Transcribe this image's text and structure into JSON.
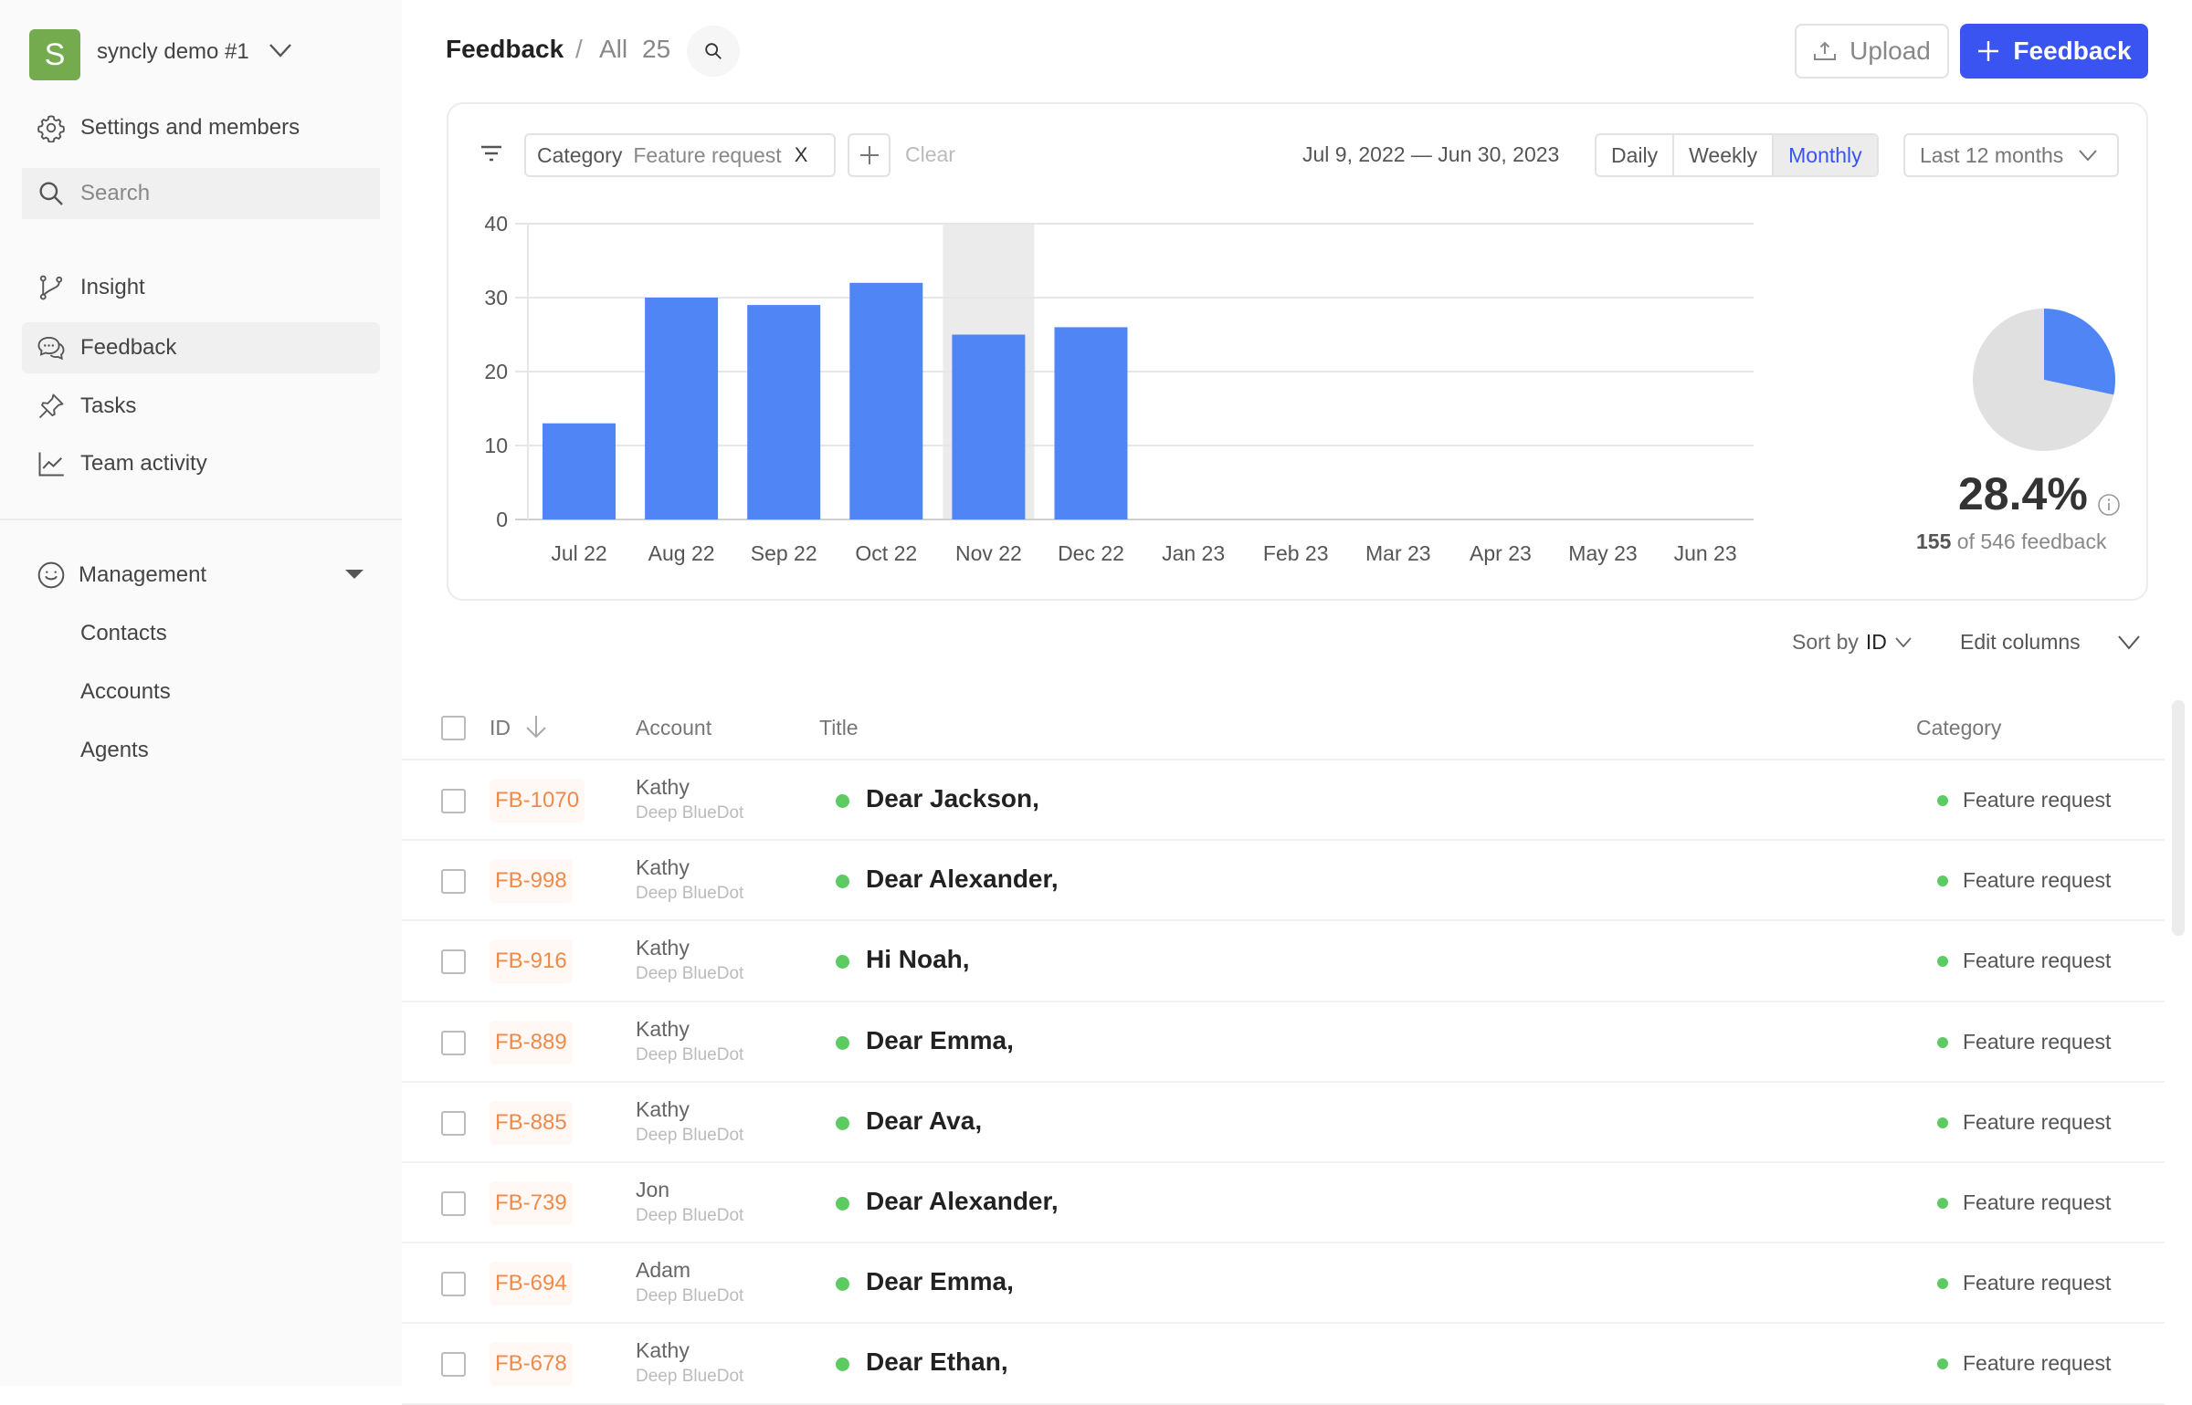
{
  "sidebar": {
    "workspace": {
      "initial": "S",
      "name": "syncly demo #1"
    },
    "settings_label": "Settings and members",
    "search_placeholder": "Search",
    "nav": [
      {
        "label": "Insight",
        "icon": "branch-icon"
      },
      {
        "label": "Feedback",
        "icon": "chat-bubbles-icon",
        "active": true
      },
      {
        "label": "Tasks",
        "icon": "pin-icon"
      },
      {
        "label": "Team activity",
        "icon": "line-chart-icon"
      }
    ],
    "management": {
      "label": "Management",
      "items": [
        "Contacts",
        "Accounts",
        "Agents"
      ]
    }
  },
  "header": {
    "title": "Feedback",
    "separator": "/",
    "view": "All",
    "count": "25",
    "upload_label": "Upload",
    "new_feedback_label": "Feedback"
  },
  "filters": {
    "chip_key": "Category",
    "chip_value": "Feature request",
    "chip_remove": "X",
    "clear_label": "Clear",
    "date_range": "Jul 9, 2022 — Jun 30, 2023",
    "granularity": [
      "Daily",
      "Weekly",
      "Monthly"
    ],
    "granularity_selected": "Monthly",
    "period": "Last 12 months"
  },
  "colors": {
    "accent": "#3a54f1",
    "bar": "#5085f5",
    "pie_rest": "#e0e0e0",
    "status_green": "#5ecb62",
    "id_orange": "#ef8a4a"
  },
  "chart_data": [
    {
      "type": "bar",
      "title": "",
      "xlabel": "",
      "ylabel": "",
      "categories": [
        "Jul 22",
        "Aug 22",
        "Sep 22",
        "Oct 22",
        "Nov 22",
        "Dec 22",
        "Jan 23",
        "Feb 23",
        "Mar 23",
        "Apr 23",
        "May 23",
        "Jun 23"
      ],
      "values": [
        13,
        30,
        29,
        32,
        25,
        26,
        0,
        0,
        0,
        0,
        0,
        0
      ],
      "yticks": [
        0,
        10,
        20,
        30,
        40
      ],
      "ylim": [
        0,
        40
      ],
      "grid": true,
      "highlighted_category": "Nov 22"
    },
    {
      "type": "pie",
      "slices": [
        {
          "label": "Feature request",
          "value": 155
        },
        {
          "label": "Other",
          "value": 391
        }
      ],
      "percent_label": "28.4%",
      "selected": "155",
      "total_text": "of 546 feedback"
    }
  ],
  "table": {
    "sort_prefix": "Sort by",
    "sort_value": "ID",
    "edit_columns_label": "Edit columns",
    "columns": {
      "id": "ID",
      "account": "Account",
      "title": "Title",
      "category": "Category"
    },
    "rows": [
      {
        "id": "FB-1070",
        "account": "Kathy",
        "org": "Deep BlueDot",
        "title": "Dear Jackson,",
        "category": "Feature request"
      },
      {
        "id": "FB-998",
        "account": "Kathy",
        "org": "Deep BlueDot",
        "title": "Dear Alexander,",
        "category": "Feature request"
      },
      {
        "id": "FB-916",
        "account": "Kathy",
        "org": "Deep BlueDot",
        "title": "Hi Noah,",
        "category": "Feature request"
      },
      {
        "id": "FB-889",
        "account": "Kathy",
        "org": "Deep BlueDot",
        "title": "Dear Emma,",
        "category": "Feature request"
      },
      {
        "id": "FB-885",
        "account": "Kathy",
        "org": "Deep BlueDot",
        "title": "Dear Ava,",
        "category": "Feature request"
      },
      {
        "id": "FB-739",
        "account": "Jon",
        "org": "Deep BlueDot",
        "title": "Dear Alexander,",
        "category": "Feature request"
      },
      {
        "id": "FB-694",
        "account": "Adam",
        "org": "Deep BlueDot",
        "title": "Dear Emma,",
        "category": "Feature request"
      },
      {
        "id": "FB-678",
        "account": "Kathy",
        "org": "Deep BlueDot",
        "title": "Dear Ethan,",
        "category": "Feature request"
      }
    ]
  }
}
